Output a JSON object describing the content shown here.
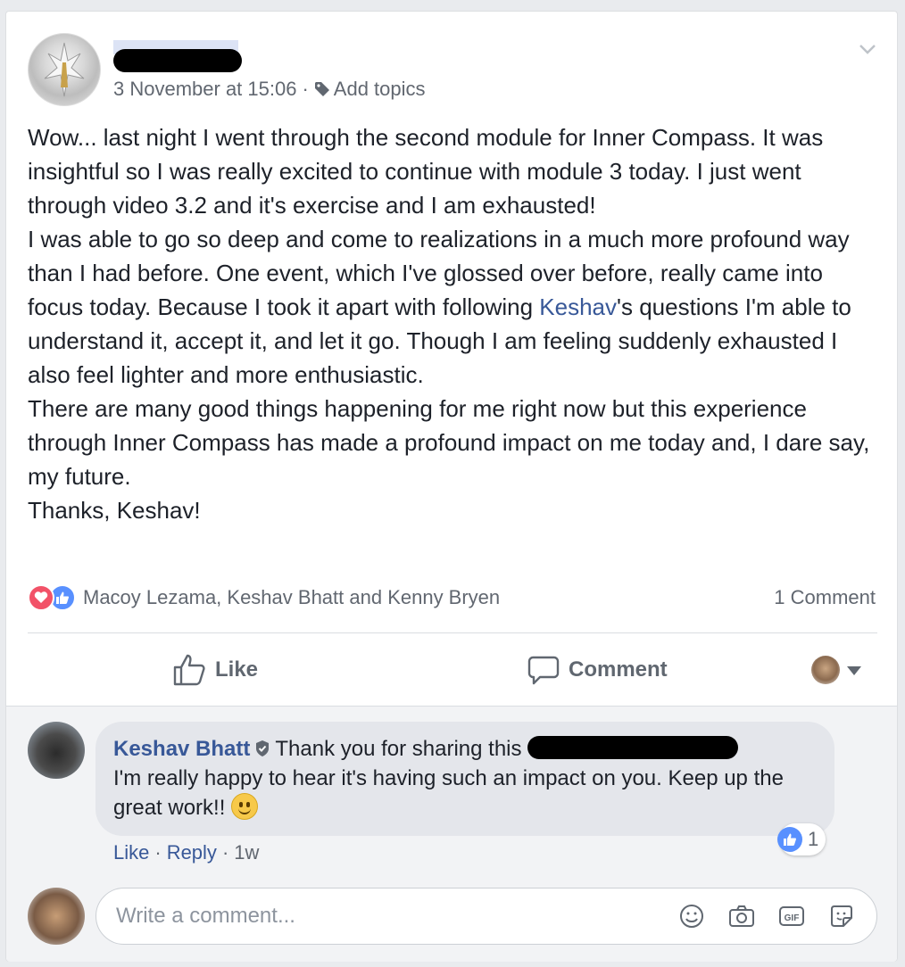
{
  "post": {
    "timestamp": "3 November at 15:06",
    "separator": "·",
    "add_topics": "Add topics",
    "paragraph1": "Wow... last night I went through the second module for Inner Compass. It was insightful so I was really excited to continue with module 3 today. I just went through video 3.2 and it's exercise and I am exhausted!",
    "paragraph2_a": "I was able to go so deep and come to realizations in a much more profound way than I had before. One event, which I've glossed over before, really came into focus today. Because I took it apart with following ",
    "paragraph2_mention": "Keshav",
    "paragraph2_b": "'s questions I'm able to understand it, accept it, and let it go. Though I am feeling suddenly exhausted I also feel lighter and more enthusiastic.",
    "paragraph3": "There are many good things happening for me right now but this experience through Inner Compass has made a profound impact on me today and, I dare say, my future.",
    "paragraph4": "Thanks, Keshav!"
  },
  "reactions": {
    "names": "Macoy Lezama, Keshav Bhatt and Kenny Bryen",
    "comment_count": "1 Comment",
    "love_color": "#f25268",
    "like_color": "#5890ff"
  },
  "actions": {
    "like_label": "Like",
    "comment_label": "Comment"
  },
  "comment": {
    "author": "Keshav Bhatt",
    "text_start": "Thank you for sharing this",
    "text_body": "I'm really happy to hear it's having such an impact on you. Keep up the great work!!",
    "like_count": "1",
    "like_action": "Like",
    "reply_action": "Reply",
    "separator": "·",
    "age": "1w"
  },
  "composer": {
    "placeholder": "Write a comment...",
    "icons": [
      "emoji-icon",
      "camera-icon",
      "gif-icon",
      "sticker-icon"
    ]
  },
  "colors": {
    "link": "#385898",
    "meta": "#616770",
    "background": "#e9ebee"
  }
}
